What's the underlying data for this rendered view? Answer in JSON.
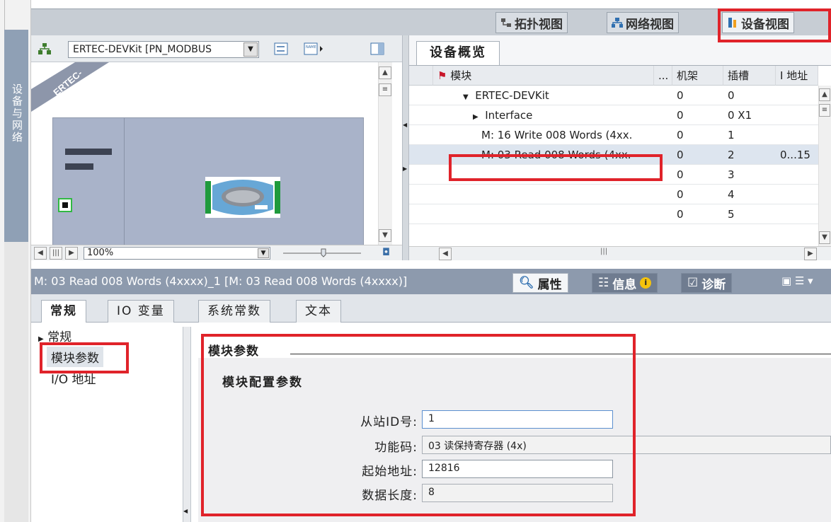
{
  "sidebar": {
    "vertical_tab": "设备与网络"
  },
  "views": {
    "topology": "拓扑视图",
    "network": "网络视图",
    "device": "设备视图"
  },
  "device_toolbar": {
    "device_select": "ERTEC-DEVKit [PN_MODBUS",
    "zoom": "100%"
  },
  "canvas": {
    "device_label": "ERTEC-"
  },
  "overview": {
    "tab": "设备概览",
    "columns": {
      "module": "模块",
      "dots": "...",
      "rack": "机架",
      "slot": "插槽",
      "iaddr": "I 地址"
    },
    "rows": [
      {
        "module": "ERTEC-DEVKit",
        "rack": "0",
        "slot": "0",
        "iaddr": ""
      },
      {
        "module": "Interface",
        "rack": "0",
        "slot": "0 X1",
        "iaddr": ""
      },
      {
        "module": "M: 16 Write 008 Words (4xx.",
        "rack": "0",
        "slot": "1",
        "iaddr": ""
      },
      {
        "module": "M: 03 Read 008 Words (4xx.",
        "rack": "0",
        "slot": "2",
        "iaddr": "0...15"
      },
      {
        "module": "",
        "rack": "0",
        "slot": "3",
        "iaddr": ""
      },
      {
        "module": "",
        "rack": "0",
        "slot": "4",
        "iaddr": ""
      },
      {
        "module": "",
        "rack": "0",
        "slot": "5",
        "iaddr": ""
      }
    ]
  },
  "properties": {
    "title": "M: 03 Read 008 Words (4xxxx)_1 [M: 03 Read 008 Words (4xxxx)]",
    "tabs": {
      "props": "属性",
      "info": "信息",
      "diag": "诊断"
    },
    "subtabs": [
      "常规",
      "IO 变量",
      "系统常数",
      "文本"
    ],
    "nav": [
      "常规",
      "模块参数",
      "I/O 地址"
    ],
    "section_title": "模块参数",
    "subsection_title": "模块配置参数",
    "fields": {
      "slave_id_label": "从站ID号:",
      "slave_id_value": "1",
      "func_label": "功能码:",
      "func_value": "03 读保持寄存器 (4x)",
      "start_label": "起始地址:",
      "start_value": "12816",
      "len_label": "数据长度:",
      "len_value": "8"
    }
  },
  "colors": {
    "highlight": "#e0232a",
    "panel_title": "#8d9aad",
    "vertical_tab": "#8fa0b5"
  }
}
